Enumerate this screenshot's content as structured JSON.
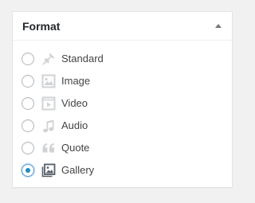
{
  "panel": {
    "title": "Format"
  },
  "formats": [
    {
      "label": "Standard",
      "icon": "pushpin-icon",
      "checked": false
    },
    {
      "label": "Image",
      "icon": "image-icon",
      "checked": false
    },
    {
      "label": "Video",
      "icon": "video-icon",
      "checked": false
    },
    {
      "label": "Audio",
      "icon": "audio-icon",
      "checked": false
    },
    {
      "label": "Quote",
      "icon": "quote-icon",
      "checked": false
    },
    {
      "label": "Gallery",
      "icon": "gallery-icon",
      "checked": true
    }
  ],
  "colors": {
    "icon_inactive": "#d0d3d6",
    "icon_active": "#555d66",
    "radio_checked": "#1e8cbe"
  }
}
